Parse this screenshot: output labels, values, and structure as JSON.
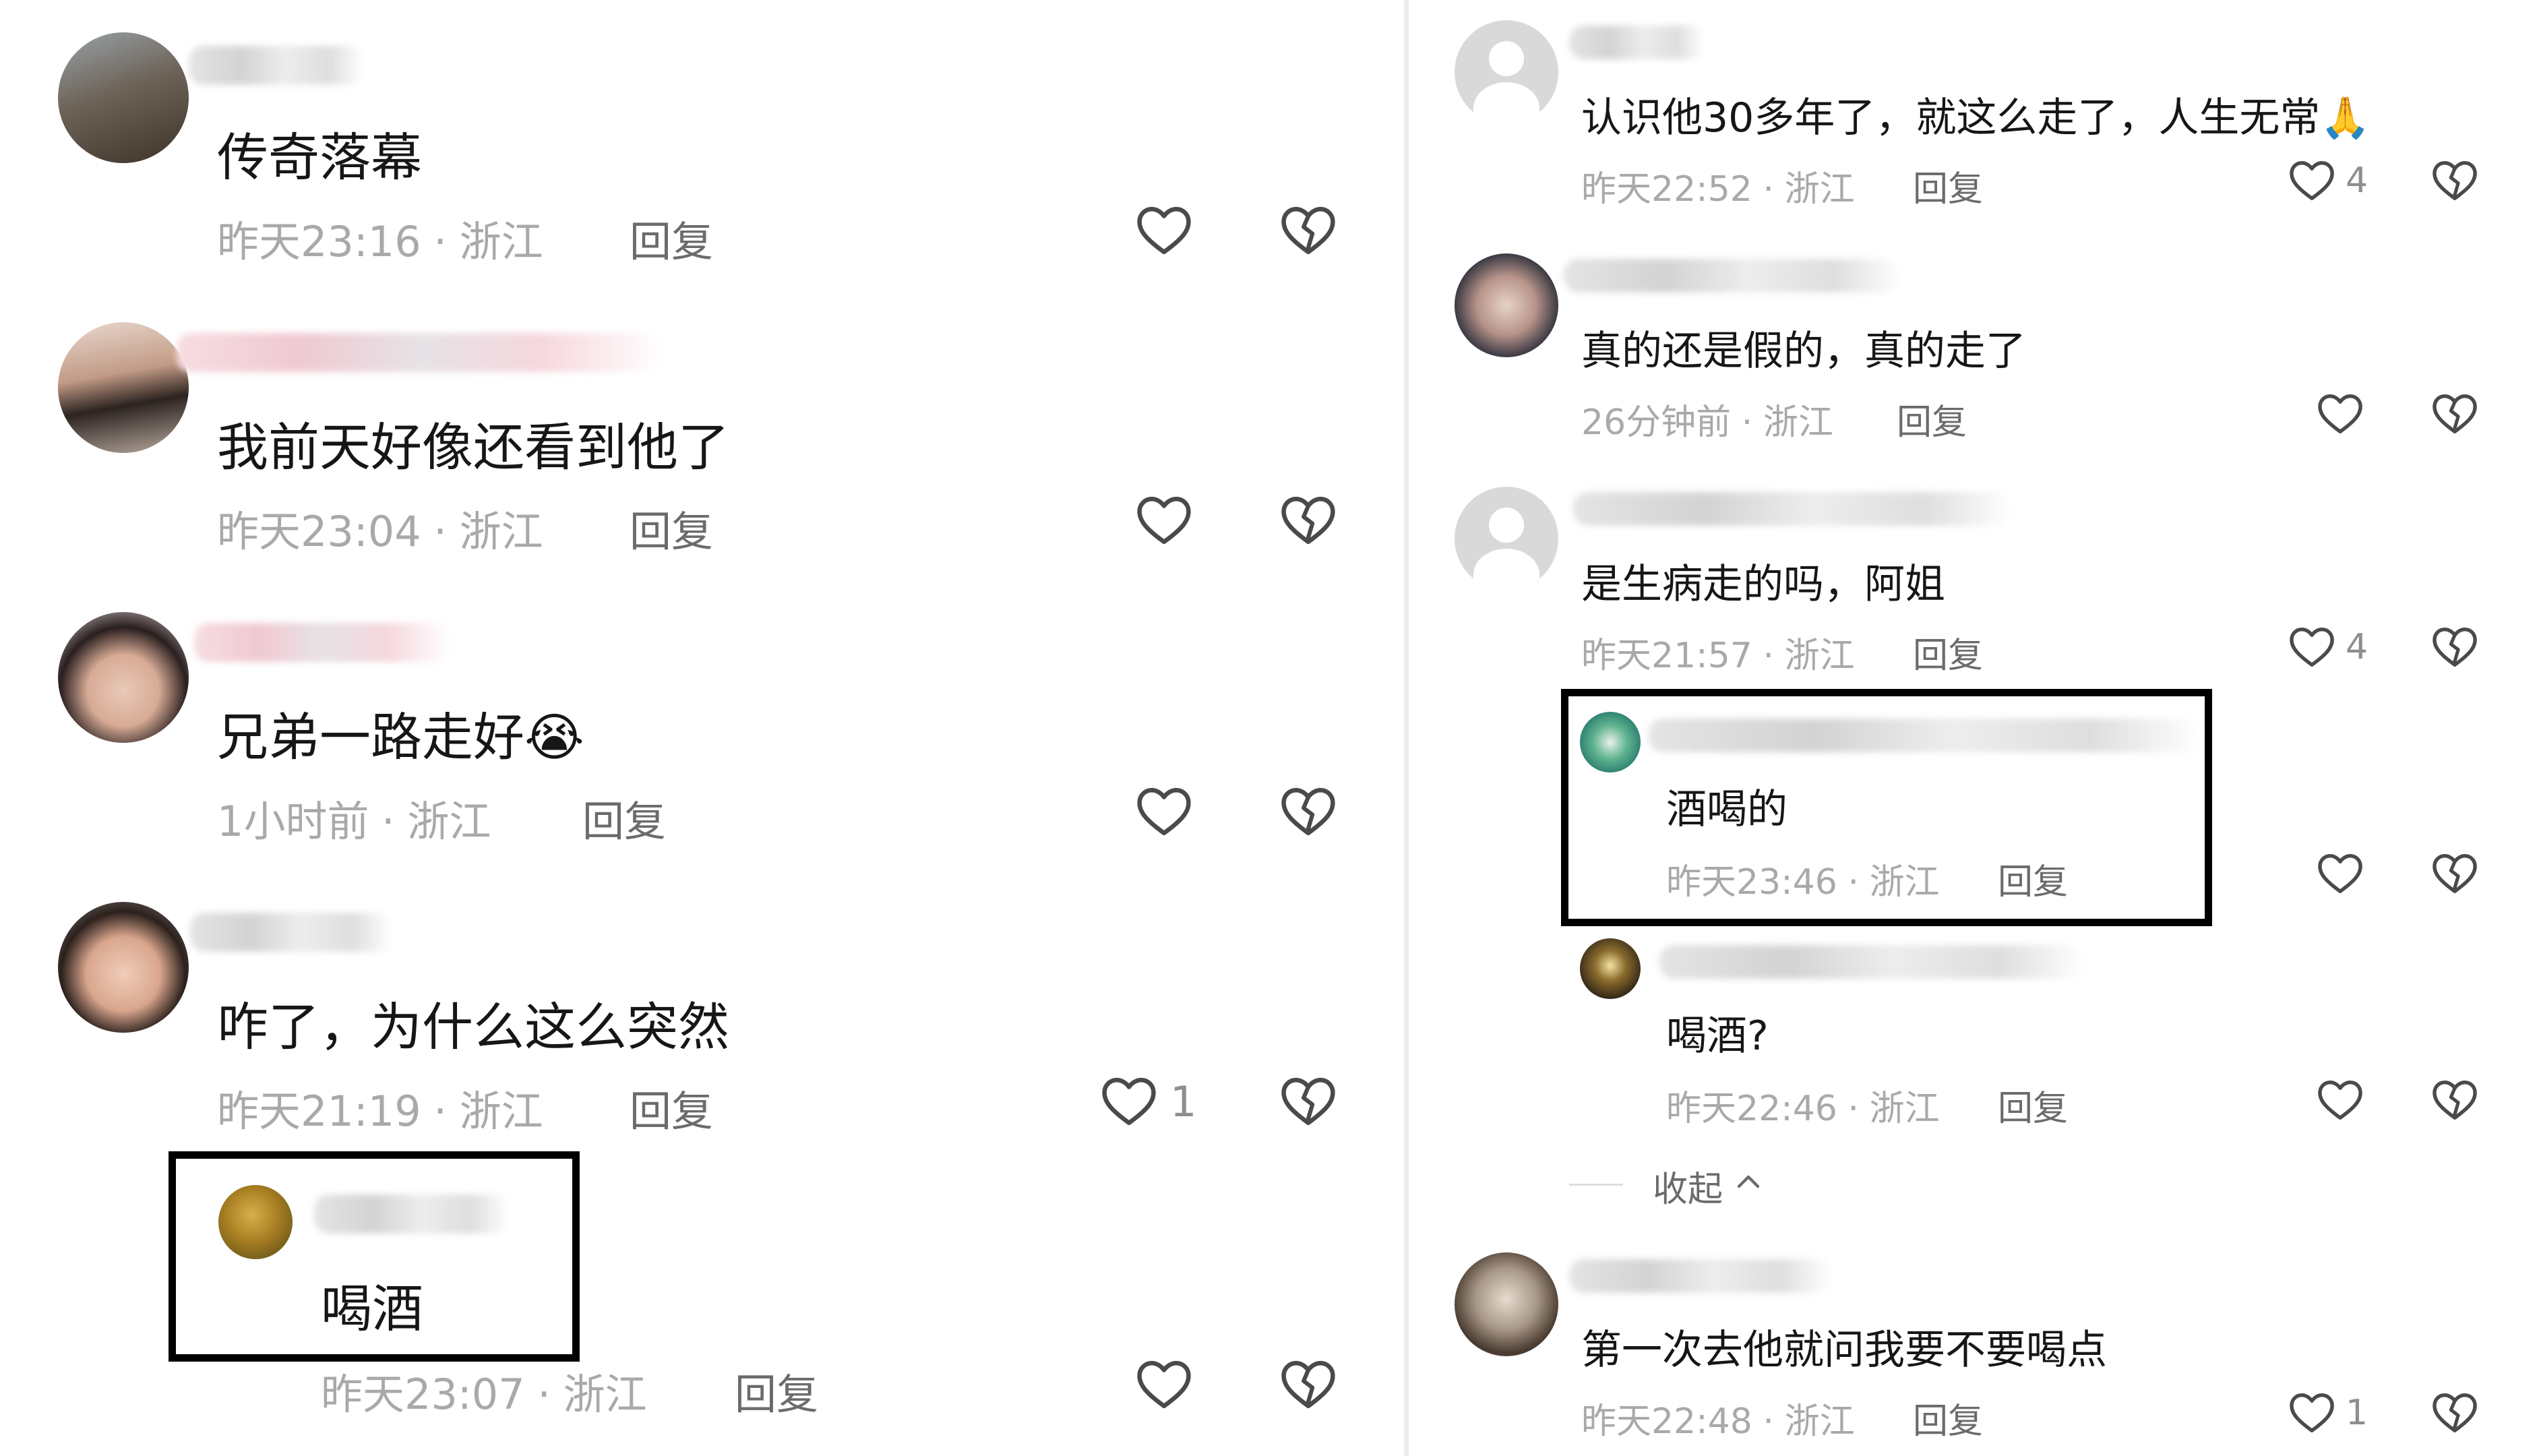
{
  "left_pane": {
    "comments": [
      {
        "text": "传奇落幕",
        "time": "昨天23:16",
        "location": "浙江",
        "reply_label": "回复"
      },
      {
        "text": "我前天好像还看到他了",
        "time": "昨天23:04",
        "location": "浙江",
        "reply_label": "回复"
      },
      {
        "text": "兄弟一路走好😭",
        "time": "1小时前",
        "location": "浙江",
        "reply_label": "回复"
      },
      {
        "text": "咋了，为什么这么突然",
        "time": "昨天21:19",
        "location": "浙江",
        "reply_label": "回复",
        "likes": "1"
      },
      {
        "text": "喝酒",
        "time": "昨天23:07",
        "location": "浙江",
        "reply_label": "回复"
      }
    ]
  },
  "right_pane": {
    "comments": [
      {
        "text": "认识他30多年了，就这么走了，人生无常🙏",
        "time": "昨天22:52",
        "location": "浙江",
        "reply_label": "回复",
        "likes": "4"
      },
      {
        "text": "真的还是假的，真的走了",
        "time": "26分钟前",
        "location": "浙江",
        "reply_label": "回复"
      },
      {
        "text": "是生病走的吗，阿姐",
        "time": "昨天21:57",
        "location": "浙江",
        "reply_label": "回复",
        "likes": "4"
      },
      {
        "text": "酒喝的",
        "time": "昨天23:46",
        "location": "浙江",
        "reply_label": "回复"
      },
      {
        "text": "喝酒?",
        "time": "昨天22:46",
        "location": "浙江",
        "reply_label": "回复"
      },
      {
        "text": "第一次去他就问我要不要喝点",
        "time": "昨天22:48",
        "location": "浙江",
        "reply_label": "回复",
        "likes": "1"
      }
    ],
    "collapse_label": "收起"
  },
  "icons": {
    "like": "heart-outline-icon",
    "dislike": "broken-heart-icon",
    "collapse": "chevron-up-icon",
    "avatar_default": "default-user-avatar-icon"
  },
  "colors": {
    "background": "#ffffff",
    "text_primary": "#161616",
    "text_meta": "#a9a9a9",
    "icon": "#4a4a4a",
    "highlight_border": "#000000"
  }
}
